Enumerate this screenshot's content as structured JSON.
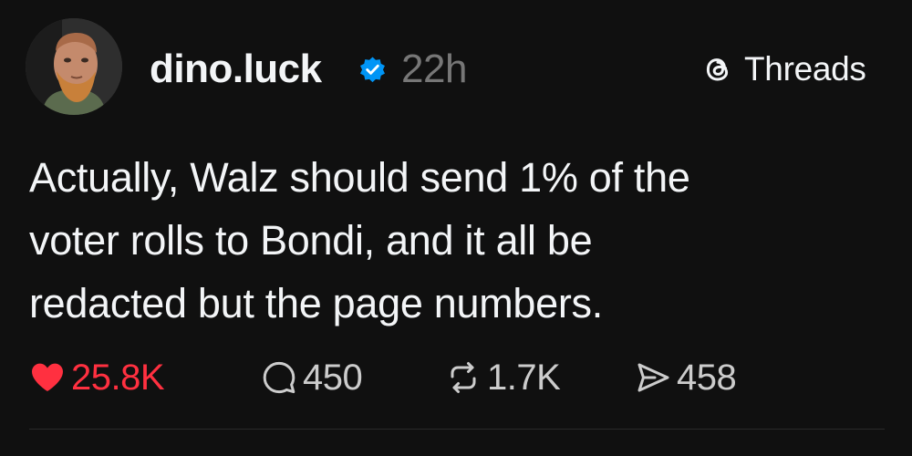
{
  "post": {
    "username": "dino.luck",
    "timestamp": "22h",
    "verified": true,
    "text": "Actually, Walz should send 1% of the\nvoter rolls to Bondi, and it all be\nredacted but the page numbers."
  },
  "brand": {
    "label": "Threads",
    "icon": "threads-logo-icon"
  },
  "stats": {
    "likes": "25.8K",
    "replies": "450",
    "reposts": "1.7K",
    "shares": "458"
  },
  "colors": {
    "background": "#101010",
    "text": "#f3f5f7",
    "muted": "#777777",
    "like": "#ff3040",
    "verified": "#0095f6"
  }
}
